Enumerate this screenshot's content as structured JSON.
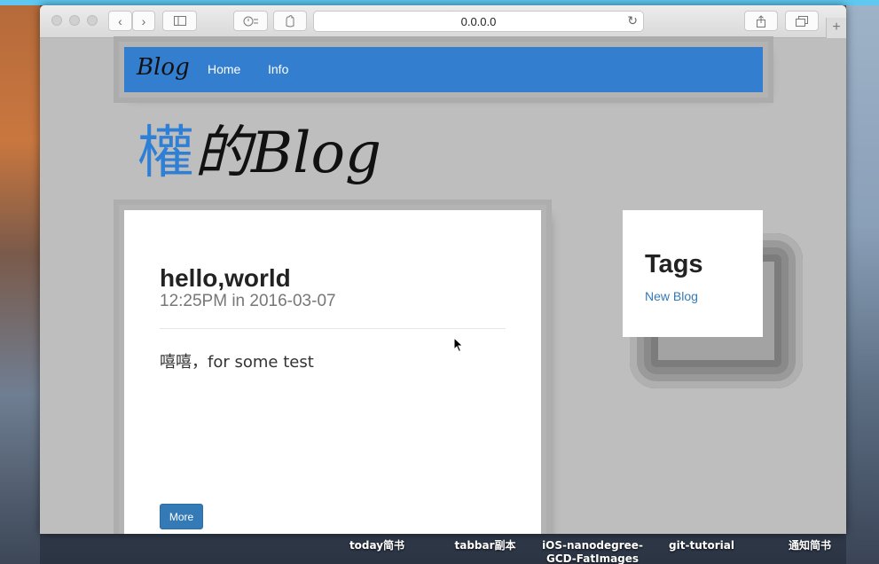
{
  "browser": {
    "url": "0.0.0.0",
    "reload_icon": "↻",
    "new_tab_icon": "+"
  },
  "navbar": {
    "brand": "Blog",
    "links": [
      "Home",
      "Info"
    ],
    "color": "#337ecf"
  },
  "site": {
    "title_accent": "權",
    "title_rest": "的Blog"
  },
  "post": {
    "title": "hello,world",
    "meta": "12:25PM in 2016-03-07",
    "body": "嘻嘻，for some test",
    "more_label": "More"
  },
  "sidebar": {
    "tags_heading": "Tags",
    "tags": [
      "New Blog"
    ]
  },
  "desktop": {
    "labels": [
      "today简书",
      "tabbar副本",
      "iOS-nanodegree-GCD-FatImages",
      "git-tutorial",
      "通知简书"
    ]
  }
}
